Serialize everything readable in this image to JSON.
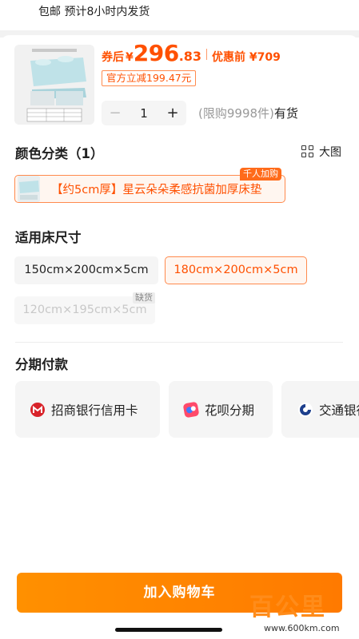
{
  "header": {
    "shipping_text": "包邮  预计8小时内发货"
  },
  "product": {
    "price_label": "券后",
    "currency": "¥",
    "price_int": "296",
    "price_dec": ".83",
    "original_price": "优惠前 ¥709",
    "coupon_text": "官方立减199.47元",
    "quantity": "1",
    "limit_text": "(限购9998件)",
    "stock_text": "有货"
  },
  "color_section": {
    "title": "颜色分类（1）",
    "view_label": "大图",
    "option_label": "【约5cm厚】星云朵朵柔感抗菌加厚床垫",
    "badge": "千人加购"
  },
  "size_section": {
    "title": "适用床尺寸",
    "options": [
      {
        "label": "150cm×200cm×5cm",
        "state": "normal"
      },
      {
        "label": "180cm×200cm×5cm",
        "state": "selected"
      },
      {
        "label": "120cm×195cm×5cm",
        "state": "soldout"
      }
    ],
    "soldout_tag": "缺货"
  },
  "installment": {
    "title": "分期付款",
    "options": [
      {
        "label": "招商银行信用卡",
        "icon": "cmb-bank-icon"
      },
      {
        "label": "花呗分期",
        "icon": "huabei-icon"
      },
      {
        "label": "交通银行",
        "icon": "bocom-bank-icon"
      }
    ]
  },
  "footer": {
    "add_to_cart": "加入购物车"
  },
  "watermark": {
    "text": "百公里",
    "url": "www.600km.com"
  },
  "colors": {
    "accent": "#ff5000",
    "button": "#ff8a00",
    "chip_bg": "#f5f5f5"
  }
}
